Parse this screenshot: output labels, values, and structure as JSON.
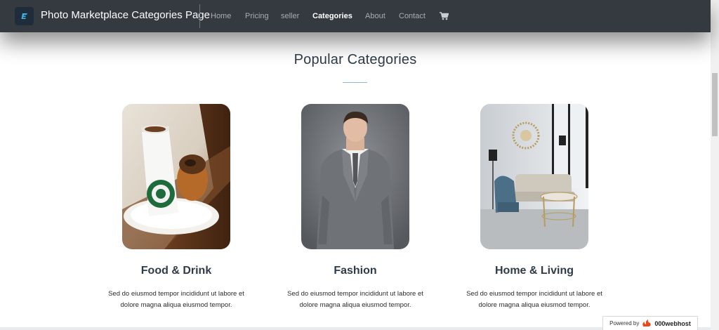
{
  "navbar": {
    "brand_title": "Photo Marketplace Categories Page",
    "links": [
      {
        "label": "Home",
        "active": false
      },
      {
        "label": "Pricing",
        "active": false
      },
      {
        "label": "seller",
        "active": false
      },
      {
        "label": "Categories",
        "active": true
      },
      {
        "label": "About",
        "active": false
      },
      {
        "label": "Contact",
        "active": false
      }
    ],
    "cart_icon": "shopping-cart-icon",
    "background_color": "#343a40"
  },
  "main": {
    "section_title": "Popular Categories",
    "cards": [
      {
        "title": "Food & Drink",
        "line1": "Sed do eiusmod tempor incididunt ut labore et",
        "line2": "dolore magna aliqua eiusmod tempor.",
        "image": "coffee-cup-and-pastry"
      },
      {
        "title": "Fashion",
        "line1": "Sed do eiusmod tempor incididunt ut labore et",
        "line2": "dolore magna aliqua eiusmod tempor.",
        "image": "man-in-grey-suit"
      },
      {
        "title": "Home & Living",
        "line1": "Sed do eiusmod tempor incididunt ut labore et",
        "line2": "dolore magna aliqua eiusmod tempor.",
        "image": "living-room-interior"
      }
    ]
  },
  "badge": {
    "powered_by": "Powered by",
    "host_name": "000webhost"
  }
}
